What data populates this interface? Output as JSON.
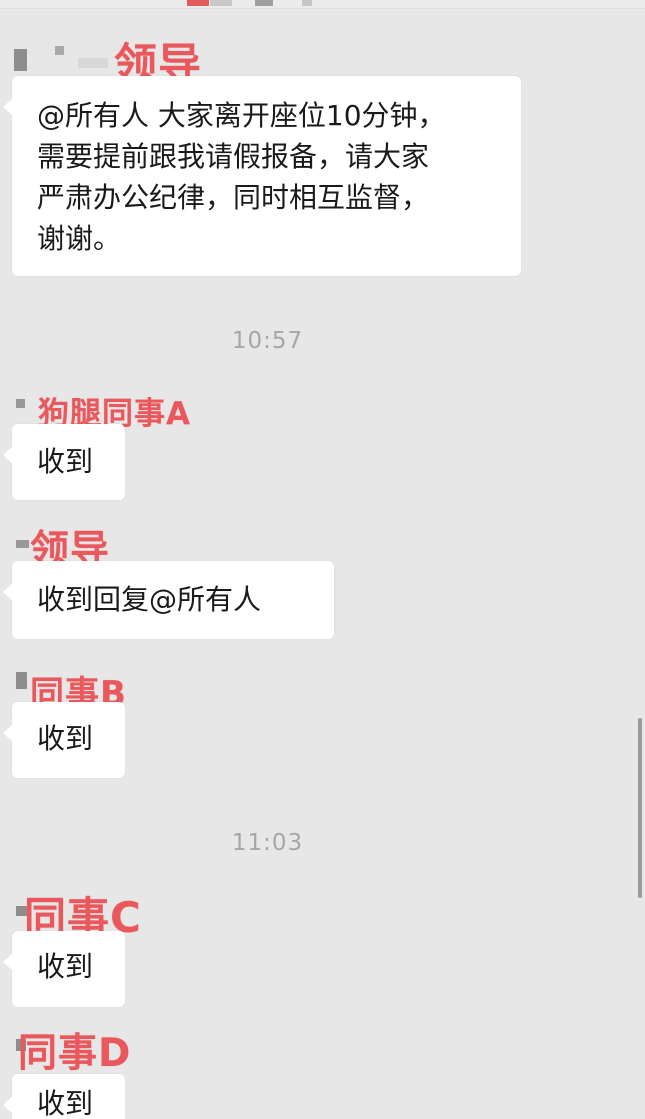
{
  "colors": {
    "background": "#e7e7e7",
    "bubble": "#ffffff",
    "sender_name": "#e8585c",
    "timestamp": "#a6a6a6",
    "message_text": "#1a1a1a"
  },
  "messages": [
    {
      "sender": "领导",
      "text": "@所有人 大家离开座位10分钟，\n需要提前跟我请假报备，请大家\n严肃办公纪律，同时相互监督，\n谢谢。"
    },
    {
      "sender": "狗腿同事A",
      "text": "收到"
    },
    {
      "sender": "领导",
      "text": "收到回复@所有人"
    },
    {
      "sender": "同事B",
      "text": "收到"
    },
    {
      "sender": "同事C",
      "text": "收到"
    },
    {
      "sender": "同事D",
      "text": "收到"
    }
  ],
  "timestamps": [
    "10:57",
    "11:03"
  ],
  "icons": {
    "avatar": "avatar-icon",
    "scrollbar": "scrollbar"
  }
}
